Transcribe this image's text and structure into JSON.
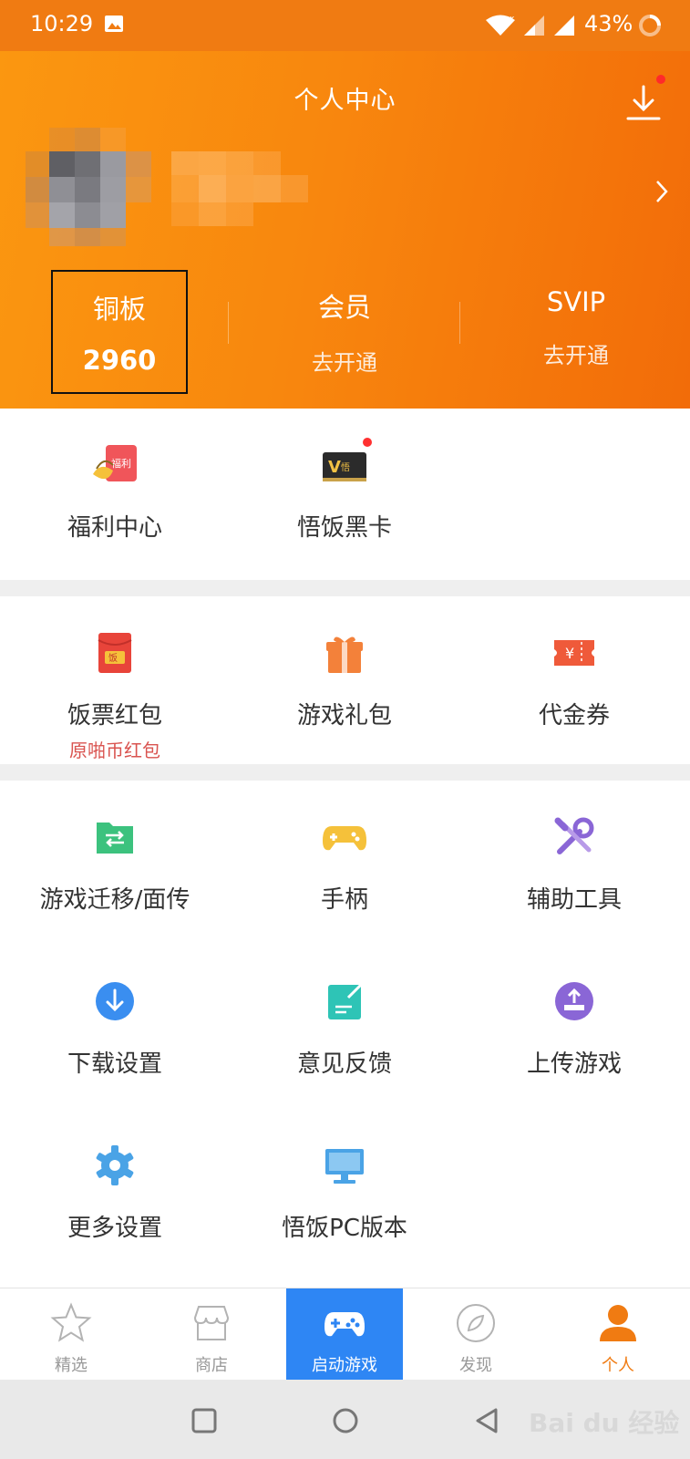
{
  "status_bar": {
    "time": "10:29",
    "battery": "43%"
  },
  "header": {
    "title": "个人中心",
    "stats": [
      {
        "label": "铜板",
        "value": "2960"
      },
      {
        "label": "会员",
        "value": "去开通"
      },
      {
        "label": "SVIP",
        "value": "去开通"
      }
    ]
  },
  "section1": [
    {
      "label": "福利中心",
      "icon": "welfare-icon"
    },
    {
      "label": "悟饭黑卡",
      "icon": "black-card-icon"
    }
  ],
  "section2": [
    {
      "label": "饭票红包",
      "sublabel": "原啪币红包",
      "icon": "red-envelope-icon"
    },
    {
      "label": "游戏礼包",
      "icon": "gift-icon"
    },
    {
      "label": "代金券",
      "icon": "coupon-icon"
    }
  ],
  "section3": [
    {
      "label": "游戏迁移/面传",
      "icon": "transfer-icon"
    },
    {
      "label": "手柄",
      "icon": "gamepad-icon"
    },
    {
      "label": "辅助工具",
      "icon": "tools-icon"
    },
    {
      "label": "下载设置",
      "icon": "download-settings-icon"
    },
    {
      "label": "意见反馈",
      "icon": "feedback-icon"
    },
    {
      "label": "上传游戏",
      "icon": "upload-icon"
    },
    {
      "label": "更多设置",
      "icon": "gear-icon"
    },
    {
      "label": "悟饭PC版本",
      "icon": "monitor-icon"
    }
  ],
  "bottom_nav": [
    {
      "label": "精选",
      "icon": "star-icon"
    },
    {
      "label": "商店",
      "icon": "store-icon"
    },
    {
      "label": "启动游戏",
      "icon": "controller-icon"
    },
    {
      "label": "发现",
      "icon": "compass-icon"
    },
    {
      "label": "个人",
      "icon": "person-icon"
    }
  ],
  "watermark": "Bai du 经验",
  "colors": {
    "brand_orange": "#f07b12",
    "launch_blue": "#2e86f4",
    "sublabel_red": "#d9534f"
  }
}
